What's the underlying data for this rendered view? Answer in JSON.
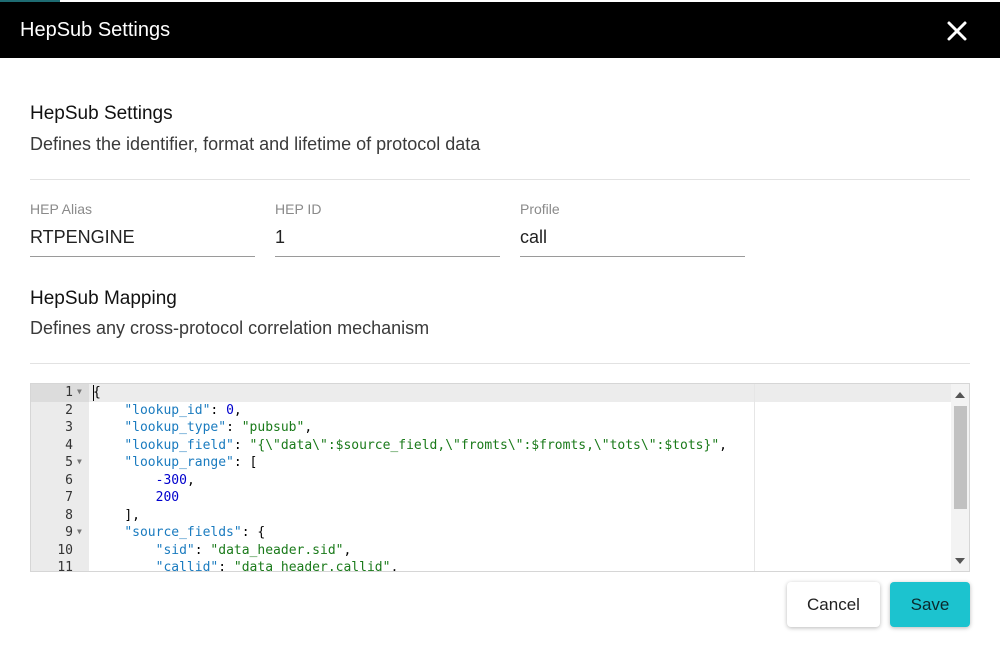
{
  "dialog": {
    "title": "HepSub Settings",
    "close_icon": "close-icon"
  },
  "settings_section": {
    "title": "HepSub Settings",
    "description": "Defines the identifier, format and lifetime of protocol data"
  },
  "fields": {
    "hep_alias": {
      "label": "HEP Alias",
      "value": "RTPENGINE"
    },
    "hep_id": {
      "label": "HEP ID",
      "value": "1"
    },
    "profile": {
      "label": "Profile",
      "value": "call"
    }
  },
  "mapping_section": {
    "title": "HepSub Mapping",
    "description": "Defines any cross-protocol correlation mechanism"
  },
  "editor": {
    "lines": [
      {
        "n": "1",
        "fold": true,
        "indent": "",
        "parts": [
          [
            "p",
            "{"
          ]
        ]
      },
      {
        "n": "2",
        "fold": false,
        "indent": "    ",
        "parts": [
          [
            "k",
            "\"lookup_id\""
          ],
          [
            "p",
            ": "
          ],
          [
            "n",
            "0"
          ],
          [
            "p",
            ","
          ]
        ]
      },
      {
        "n": "3",
        "fold": false,
        "indent": "    ",
        "parts": [
          [
            "k",
            "\"lookup_type\""
          ],
          [
            "p",
            ": "
          ],
          [
            "s",
            "\"pubsub\""
          ],
          [
            "p",
            ","
          ]
        ]
      },
      {
        "n": "4",
        "fold": false,
        "indent": "    ",
        "parts": [
          [
            "k",
            "\"lookup_field\""
          ],
          [
            "p",
            ": "
          ],
          [
            "s",
            "\"{\\\"data\\\":$source_field,\\\"fromts\\\":$fromts,\\\"tots\\\":$tots}\""
          ],
          [
            "p",
            ","
          ]
        ]
      },
      {
        "n": "5",
        "fold": true,
        "indent": "    ",
        "parts": [
          [
            "k",
            "\"lookup_range\""
          ],
          [
            "p",
            ": ["
          ]
        ]
      },
      {
        "n": "6",
        "fold": false,
        "indent": "        ",
        "parts": [
          [
            "n",
            "-300"
          ],
          [
            "p",
            ","
          ]
        ]
      },
      {
        "n": "7",
        "fold": false,
        "indent": "        ",
        "parts": [
          [
            "n",
            "200"
          ]
        ]
      },
      {
        "n": "8",
        "fold": false,
        "indent": "    ",
        "parts": [
          [
            "p",
            "],"
          ]
        ]
      },
      {
        "n": "9",
        "fold": true,
        "indent": "    ",
        "parts": [
          [
            "k",
            "\"source_fields\""
          ],
          [
            "p",
            ": {"
          ]
        ]
      },
      {
        "n": "10",
        "fold": false,
        "indent": "        ",
        "parts": [
          [
            "k",
            "\"sid\""
          ],
          [
            "p",
            ": "
          ],
          [
            "s",
            "\"data_header.sid\""
          ],
          [
            "p",
            ","
          ]
        ]
      },
      {
        "n": "11",
        "fold": false,
        "indent": "        ",
        "parts": [
          [
            "k",
            "\"callid\""
          ],
          [
            "p",
            ": "
          ],
          [
            "s",
            "\"data_header.callid\""
          ],
          [
            "p",
            ","
          ]
        ]
      }
    ]
  },
  "buttons": {
    "cancel": "Cancel",
    "save": "Save"
  }
}
